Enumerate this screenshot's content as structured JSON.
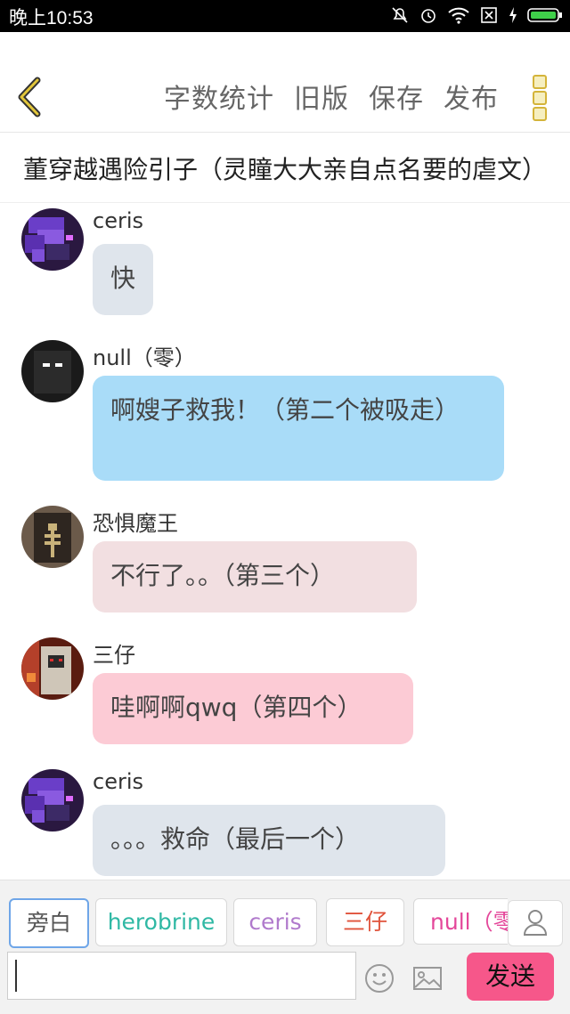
{
  "status_bar": {
    "time": "晚上10:53"
  },
  "toolbar": {
    "actions": [
      "字数统计",
      "旧版",
      "保存",
      "发布"
    ]
  },
  "story_title": "董穿越遇险引子（灵瞳大大亲自点名要的虐文）",
  "messages": [
    {
      "name": "ceris",
      "text": "快",
      "color": "#dfe5ec"
    },
    {
      "name": "null（零）",
      "text": "啊嫂子救我！（第二个被吸走）",
      "color": "#a9dcf8"
    },
    {
      "name": "恐惧魔王",
      "text": "不行了。。（第三个）",
      "color": "#f2dfe1"
    },
    {
      "name": "三仔",
      "text": "哇啊啊qwq（第四个）",
      "color": "#fccbd5"
    },
    {
      "name": "ceris",
      "text": "。。。救命（最后一个）",
      "color": "#dfe5ec"
    }
  ],
  "character_chips": [
    {
      "label": "旁白",
      "color": "#555555"
    },
    {
      "label": "herobrine",
      "color": "#2fb8a4"
    },
    {
      "label": "ceris",
      "color": "#b07acc"
    },
    {
      "label": "三仔",
      "color": "#e0533b"
    },
    {
      "label": "null（零",
      "color": "#e4479a"
    }
  ],
  "composer": {
    "input_value": "",
    "send_label": "发送"
  }
}
